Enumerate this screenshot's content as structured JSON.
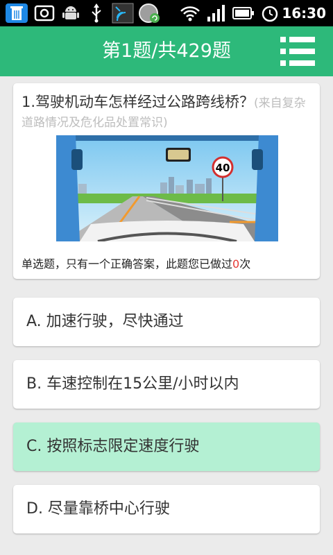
{
  "status_bar": {
    "time": "16:30",
    "icons": [
      "trash-icon",
      "screenshot-icon",
      "android-icon",
      "usb-icon",
      "media-cast-icon",
      "sync-icon",
      "wifi-icon",
      "signal-icon",
      "battery-icon",
      "alarm-icon"
    ]
  },
  "header": {
    "title": "第1题/共429题",
    "menu_icon": "list-menu-icon",
    "background": "#2db97a"
  },
  "question": {
    "text": "1.驾驶机动车怎样经过公路跨线桥？",
    "source": "(来自复杂道路情况及危化品处置常识)",
    "image_description_icon": "road-bridge-photo",
    "speed_sign": "40",
    "meta_prefix": "单选题，只有一个正确答案，此题您已做过",
    "meta_count": "0",
    "meta_suffix": "次"
  },
  "options": [
    {
      "label": "A. 加速行驶，尽快通过",
      "selected": false
    },
    {
      "label": "B. 车速控制在15公里/小时以内",
      "selected": false
    },
    {
      "label": "C. 按照标志限定速度行驶",
      "selected": true
    },
    {
      "label": "D. 尽量靠桥中心行驶",
      "selected": false
    }
  ],
  "colors": {
    "accent": "#2db97a",
    "selected_option_bg": "#b4f0d3",
    "count_highlight": "#e53935"
  }
}
